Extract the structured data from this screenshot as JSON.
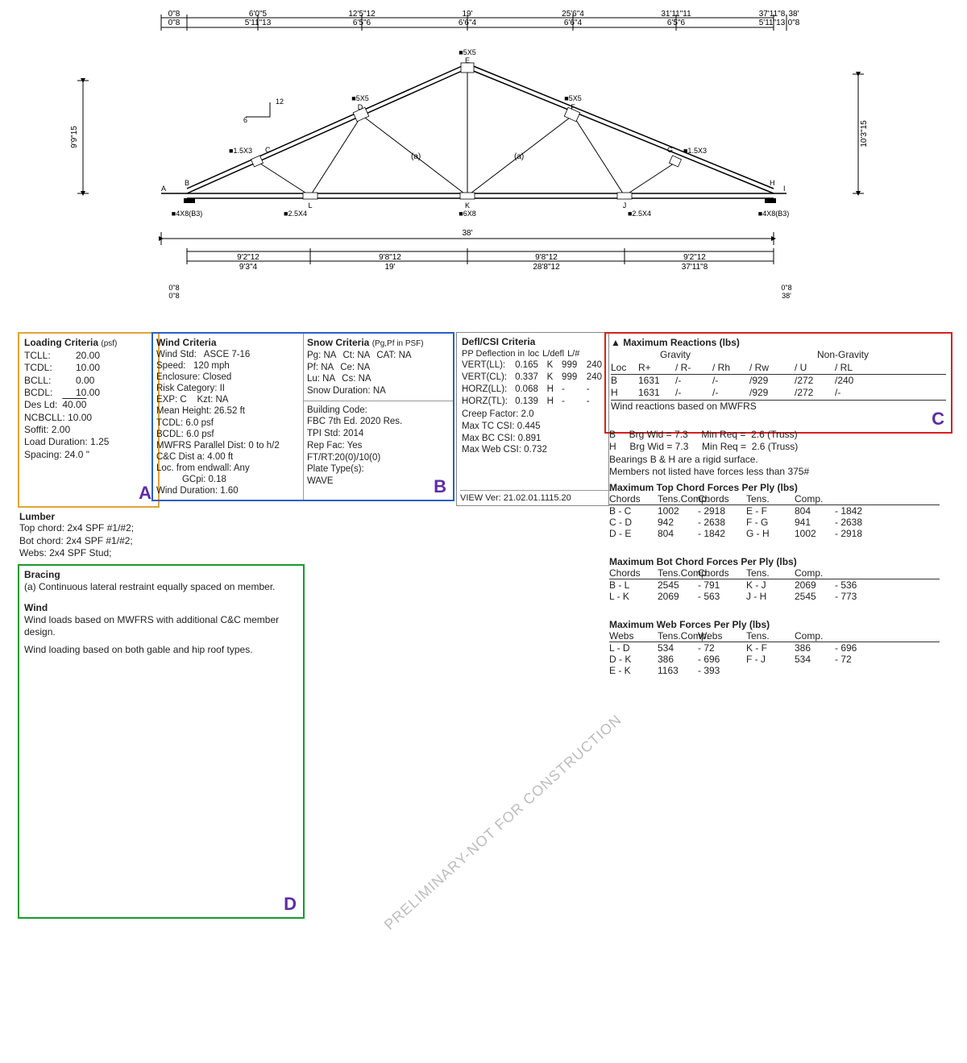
{
  "diagram": {
    "span": "38'",
    "top_dims": [
      "0\"8",
      "6'0\"5",
      "12'5\"12",
      "19'",
      "25'6\"4",
      "31'11\"11",
      "37'11\"8",
      "38'"
    ],
    "top_dims2": [
      "0\"8",
      "5'11\"13",
      "6'5\"6",
      "6'6\"4",
      "6'6\"4",
      "6'5\"6",
      "5'11\"13",
      "0\"8"
    ],
    "left_height": "9'9\"15",
    "right_height": "10'3\"15",
    "pitch_rise": "12",
    "pitch_run": "6",
    "joints": [
      "A",
      "B",
      "C",
      "D",
      "E",
      "F",
      "G",
      "H",
      "I",
      "J",
      "K",
      "L"
    ],
    "plates": {
      "A": "4X8(B3)",
      "L": "2.5X4",
      "K": "6X8",
      "J": "2.5X4",
      "I": "4X8(B3)",
      "C": "1.5X3",
      "D": "5X5",
      "E": "5X5",
      "F": "5X5",
      "G": "1.5X3"
    },
    "bot_dims": [
      "9'2\"12",
      "9'8\"12",
      "9'8\"12",
      "9'2\"12"
    ],
    "bot_dims2": [
      "9'3\"4",
      "19'",
      "28'8\"12",
      "37'11\"8"
    ],
    "left_bot": "0\"8 / 0\"8",
    "right_bot": "0\"8 / 38'"
  },
  "boxA": {
    "title": "Loading Criteria",
    "unit": "(psf)",
    "rows": [
      [
        "TCLL:",
        "20.00"
      ],
      [
        "TCDL:",
        "10.00"
      ],
      [
        "BCLL:",
        "0.00"
      ],
      [
        "BCDL:",
        "10.00"
      ]
    ],
    "des_ld_label": "Des Ld:",
    "des_ld": "40.00",
    "extra": [
      [
        "NCBCLL:",
        "10.00"
      ],
      [
        "Soffit:",
        "2.00"
      ],
      [
        "Load Duration:",
        "1.25"
      ],
      [
        "Spacing:",
        "24.0 \""
      ]
    ]
  },
  "boxB_left": {
    "title": "Wind Criteria",
    "rows": [
      "Wind Std:   ASCE 7-16",
      "Speed:   120 mph",
      "Enclosure: Closed",
      "Risk Category: II",
      "EXP: C    Kzt: NA",
      "Mean Height: 26.52 ft",
      "TCDL: 6.0 psf",
      "BCDL: 6.0 psf",
      "MWFRS Parallel Dist: 0 to h/2",
      "C&C Dist a: 4.00 ft",
      "Loc. from endwall: Any",
      "          GCpi: 0.18",
      "Wind Duration: 1.60"
    ]
  },
  "boxB_right": {
    "snow_title": "Snow Criteria",
    "snow_unit": "(Pg,Pf in PSF)",
    "snow_rows": [
      [
        "Pg: NA",
        "Ct: NA",
        "CAT: NA"
      ],
      [
        "Pf: NA",
        "",
        "Ce: NA"
      ],
      [
        "Lu: NA",
        "Cs: NA",
        ""
      ],
      [
        "Snow Duration: NA",
        "",
        ""
      ]
    ],
    "code_rows": [
      "Building Code:",
      "FBC 7th Ed. 2020 Res.",
      "TPI Std:   2014",
      "Rep Fac: Yes",
      "FT/RT:20(0)/10(0)",
      "Plate Type(s):",
      "WAVE"
    ]
  },
  "defl": {
    "title": "Defl/CSI Criteria",
    "head": [
      "PP Deflection in",
      "loc",
      "L/defl",
      "L/#"
    ],
    "rows": [
      [
        "VERT(LL):",
        "0.165",
        "K",
        "999",
        "240"
      ],
      [
        "VERT(CL):",
        "0.337",
        "K",
        "999",
        "240"
      ],
      [
        "HORZ(LL):",
        "0.068",
        "H",
        "-",
        "-"
      ],
      [
        "HORZ(TL):",
        "0.139",
        "H",
        "-",
        "-"
      ]
    ],
    "extra": [
      [
        "Creep Factor:",
        "2.0"
      ],
      [
        "Max TC CSI:",
        "0.445"
      ],
      [
        "Max BC CSI:",
        "0.891"
      ],
      [
        "Max Web CSI:",
        "0.732"
      ]
    ],
    "view": "VIEW Ver: 21.02.01.1115.20"
  },
  "boxC": {
    "title": "▲ Maximum Reactions (lbs)",
    "grav": "Gravity",
    "ngrav": "Non-Gravity",
    "head": [
      "Loc",
      "R+",
      "/ R-",
      "/ Rh",
      "/ Rw",
      "/ U",
      "/ RL"
    ],
    "rows": [
      [
        "B",
        "1631",
        "/-",
        "/-",
        "/929",
        "/272",
        "/240"
      ],
      [
        "H",
        "1631",
        "/-",
        "/-",
        "/929",
        "/272",
        "/-"
      ]
    ],
    "note": "Wind reactions based on MWFRS"
  },
  "below_c": [
    "B     Brg Wid = 7.3     Min Req =  2.6 (Truss)",
    "H     Brg Wid = 7.3     Min Req =  2.6 (Truss)",
    "Bearings B & H are a rigid surface.",
    "Members not listed have forces less than 375#"
  ],
  "forces_tc": {
    "title": "Maximum Top Chord Forces Per Ply (lbs)",
    "head": [
      "Chords",
      "Tens.Comp.",
      "Chords",
      "Tens.",
      "Comp."
    ],
    "rows": [
      [
        "B - C",
        "1002",
        "- 2918",
        "E - F",
        "804",
        "- 1842"
      ],
      [
        "C - D",
        "942",
        "- 2638",
        "F - G",
        "941",
        "- 2638"
      ],
      [
        "D - E",
        "804",
        "- 1842",
        "G - H",
        "1002",
        "- 2918"
      ]
    ]
  },
  "forces_bc": {
    "title": "Maximum Bot Chord Forces Per Ply (lbs)",
    "head": [
      "Chords",
      "Tens.Comp.",
      "Chords",
      "Tens.",
      "Comp."
    ],
    "rows": [
      [
        "B - L",
        "2545",
        "- 791",
        "K - J",
        "2069",
        "- 536"
      ],
      [
        "L - K",
        "2069",
        "- 563",
        "J - H",
        "2545",
        "- 773"
      ]
    ]
  },
  "forces_web": {
    "title": "Maximum Web Forces Per Ply (lbs)",
    "head": [
      "Webs",
      "Tens.Comp.",
      "Webs",
      "Tens.",
      "Comp."
    ],
    "rows": [
      [
        "L - D",
        "534",
        "- 72",
        "K - F",
        "386",
        "- 696"
      ],
      [
        "D - K",
        "386",
        "- 696",
        "F - J",
        "534",
        "- 72"
      ],
      [
        "E - K",
        "1163",
        "- 393",
        "",
        "",
        ""
      ]
    ]
  },
  "lumber": {
    "title": "Lumber",
    "lines": [
      "Top chord: 2x4 SPF #1/#2;",
      "Bot chord: 2x4 SPF #1/#2;",
      "Webs: 2x4 SPF Stud;"
    ]
  },
  "boxD": {
    "bracing_title": "Bracing",
    "bracing": "(a) Continuous lateral restraint equally spaced on member.",
    "wind_title": "Wind",
    "wind1": "Wind loads based on MWFRS with additional C&C member design.",
    "wind2": "Wind loading based on both gable and hip roof types."
  },
  "watermark": "PRELIMINARY-NOT FOR CONSTRUCTION",
  "letters": {
    "A": "A",
    "B": "B",
    "C": "C",
    "D": "D"
  }
}
